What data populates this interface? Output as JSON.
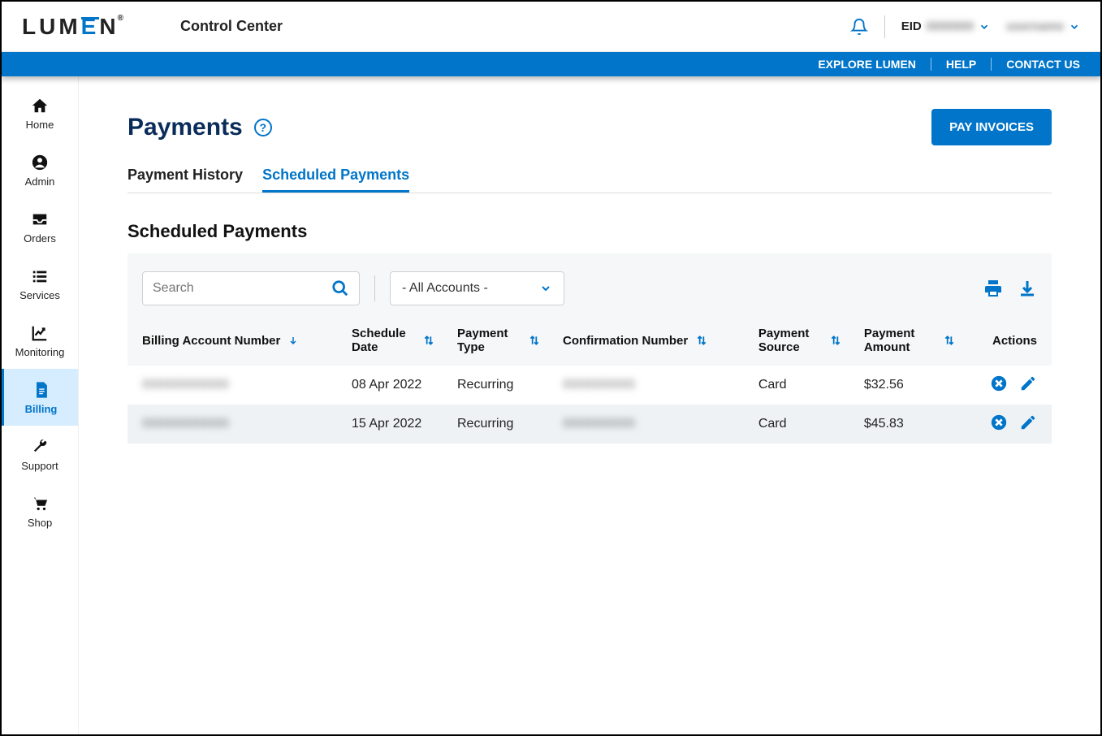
{
  "header": {
    "logo_text": "LUMEN",
    "app_title": "Control Center",
    "eid_label": "EID",
    "eid_value": "0000000",
    "username": "username"
  },
  "bluebar": {
    "explore": "EXPLORE LUMEN",
    "help": "HELP",
    "contact": "CONTACT US"
  },
  "sidebar": {
    "items": [
      {
        "label": "Home"
      },
      {
        "label": "Admin"
      },
      {
        "label": "Orders"
      },
      {
        "label": "Services"
      },
      {
        "label": "Monitoring"
      },
      {
        "label": "Billing"
      },
      {
        "label": "Support"
      },
      {
        "label": "Shop"
      }
    ]
  },
  "page": {
    "title": "Payments",
    "pay_invoices_button": "PAY INVOICES",
    "tabs": [
      {
        "label": "Payment History"
      },
      {
        "label": "Scheduled Payments"
      }
    ],
    "section_title": "Scheduled Payments"
  },
  "table": {
    "search_placeholder": "Search",
    "account_filter": "- All Accounts -",
    "headers": {
      "billing_account": "Billing Account Number",
      "schedule_date": "Schedule Date",
      "payment_type": "Payment Type",
      "confirmation_number": "Confirmation Number",
      "payment_source": "Payment Source",
      "payment_amount": "Payment Amount",
      "actions": "Actions"
    },
    "rows": [
      {
        "billing_account": "000000000000",
        "schedule_date": "08 Apr 2022",
        "payment_type": "Recurring",
        "confirmation_number": "0000000000",
        "payment_source": "Card",
        "payment_amount": "$32.56"
      },
      {
        "billing_account": "000000000000",
        "schedule_date": "15 Apr 2022",
        "payment_type": "Recurring",
        "confirmation_number": "0000000000",
        "payment_source": "Card",
        "payment_amount": "$45.83"
      }
    ]
  }
}
